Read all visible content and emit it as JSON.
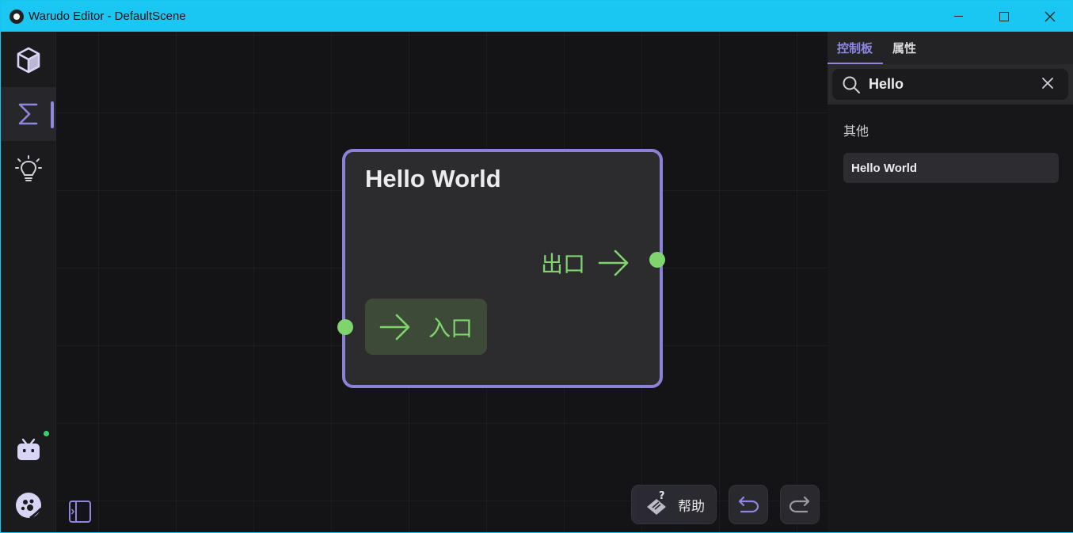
{
  "window": {
    "title": "Warudo Editor - DefaultScene"
  },
  "sidebar": {
    "items": [
      {
        "name": "scene",
        "icon": "cube-icon"
      },
      {
        "name": "blueprint",
        "icon": "sigma-icon",
        "active": true
      },
      {
        "name": "ideas",
        "icon": "lightbulb-icon"
      },
      {
        "name": "bilibili",
        "icon": "tv-icon",
        "notification": true
      },
      {
        "name": "warudo",
        "icon": "warudo-logo-icon"
      }
    ]
  },
  "node": {
    "title": "Hello World",
    "output_label": "出口",
    "input_label": "入口",
    "accent_color": "#8b82d8",
    "port_color": "#7fd46e"
  },
  "toolbar": {
    "help_label": "帮助"
  },
  "right_panel": {
    "tabs": [
      {
        "label": "控制板",
        "active": true
      },
      {
        "label": "属性",
        "active": false
      }
    ],
    "search": {
      "value": "Hello"
    },
    "section": "其他",
    "results": [
      "Hello World"
    ]
  },
  "colors": {
    "titlebar": "#1ac6f2",
    "accent": "#8f86e0",
    "green": "#7fd46e"
  }
}
